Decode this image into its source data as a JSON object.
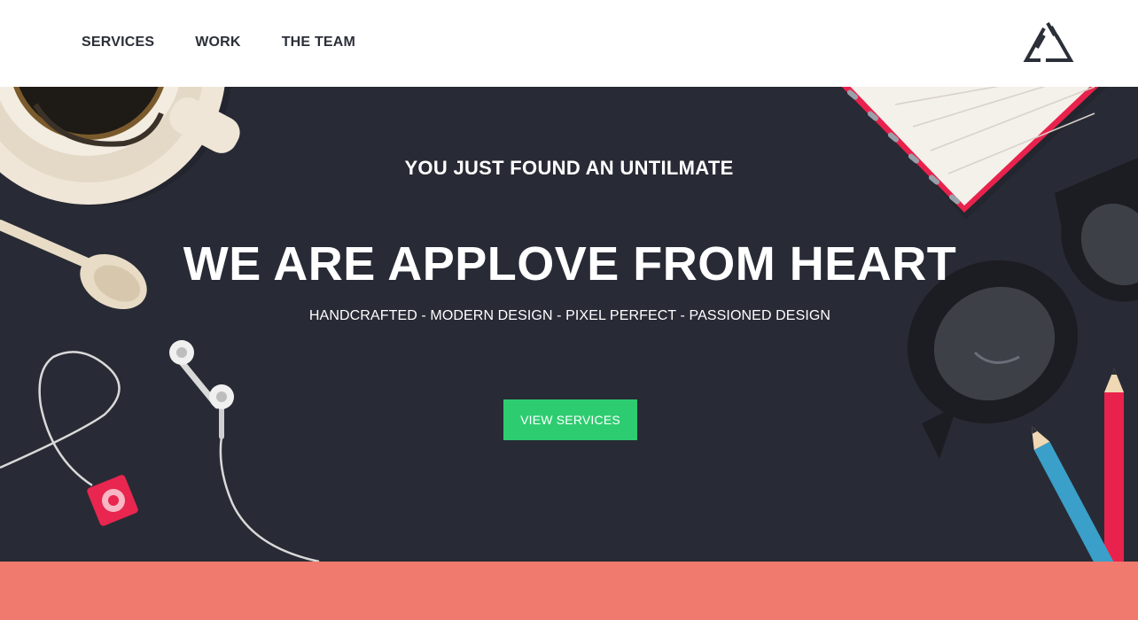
{
  "nav": {
    "items": [
      {
        "label": "SERVICES"
      },
      {
        "label": "WORK"
      },
      {
        "label": "THE TEAM"
      }
    ]
  },
  "logo": {
    "icon": "triangle-logo-icon"
  },
  "hero": {
    "kicker": "YOU JUST FOUND AN UNTILMATE",
    "headline": "WE ARE APPLOVE FROM HEART",
    "tagline": "HANDCRAFTED - MODERN DESIGN - PIXEL PERFECT - PASSIONED DESIGN",
    "cta_label": "VIEW SERVICES",
    "background_color": "#282b35",
    "cta_color": "#2ecc71"
  },
  "band": {
    "color": "#f07a6e"
  }
}
